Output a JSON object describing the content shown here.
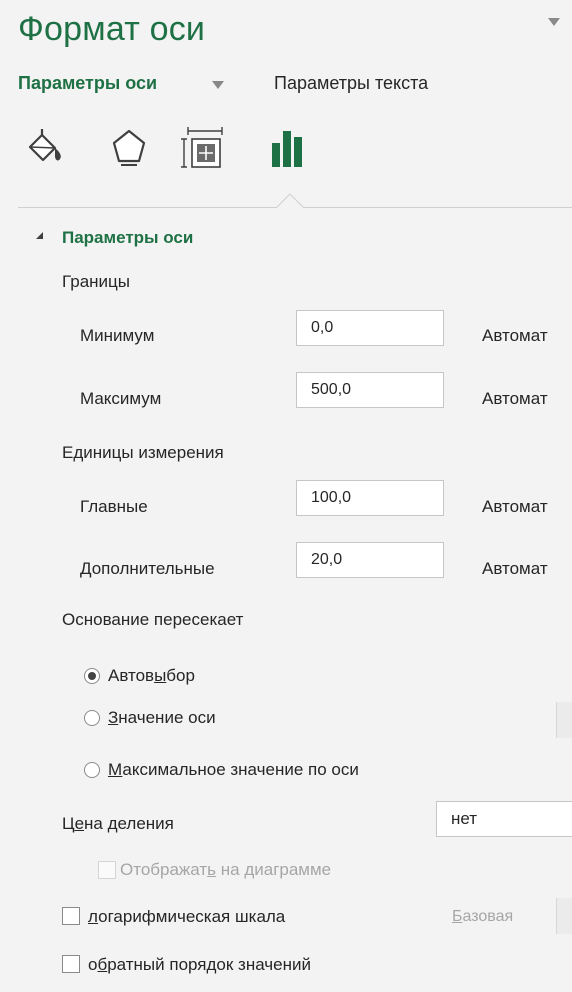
{
  "pane": {
    "title": "Формат оси"
  },
  "tabs": {
    "axis_options": "Параметры оси",
    "text_options": "Параметры текста"
  },
  "icons": [
    "fill-line-icon",
    "effects-icon",
    "size-properties-icon",
    "axis-options-icon"
  ],
  "section": {
    "title": "Параметры оси"
  },
  "bounds": {
    "heading": "Границы",
    "minimum_label": "Минимум",
    "minimum_value": "0,0",
    "maximum_label": "Максимум",
    "maximum_value": "500,0",
    "auto_label": "Автомат"
  },
  "units": {
    "heading": "Единицы измерения",
    "major_label": "Главные",
    "major_value": "100,0",
    "minor_label": "Дополнительные",
    "minor_value": "20,0",
    "auto_label": "Автомат"
  },
  "crosses": {
    "heading": "Основание пересекает",
    "option_auto_pre": "Автов",
    "option_auto_u": "ы",
    "option_auto_post": "бор",
    "option_value_u": "З",
    "option_value_post": "начение оси",
    "option_max_u": "М",
    "option_max_post": "аксимальное значение по оси",
    "selected": "auto"
  },
  "display_units": {
    "label_pre": "Ц",
    "label_u": "е",
    "label_post": "на деления",
    "value": "нет",
    "show_on_chart_pre": "Отображат",
    "show_on_chart_u": "ь",
    "show_on_chart_post": " на диаграмме"
  },
  "log_scale": {
    "label_u": "л",
    "label_post": "огарифмическая шкала",
    "base_u": "Б",
    "base_post": "азовая"
  },
  "reverse": {
    "label_pre": "о",
    "label_u": "б",
    "label_post": "ратный порядок значений"
  }
}
